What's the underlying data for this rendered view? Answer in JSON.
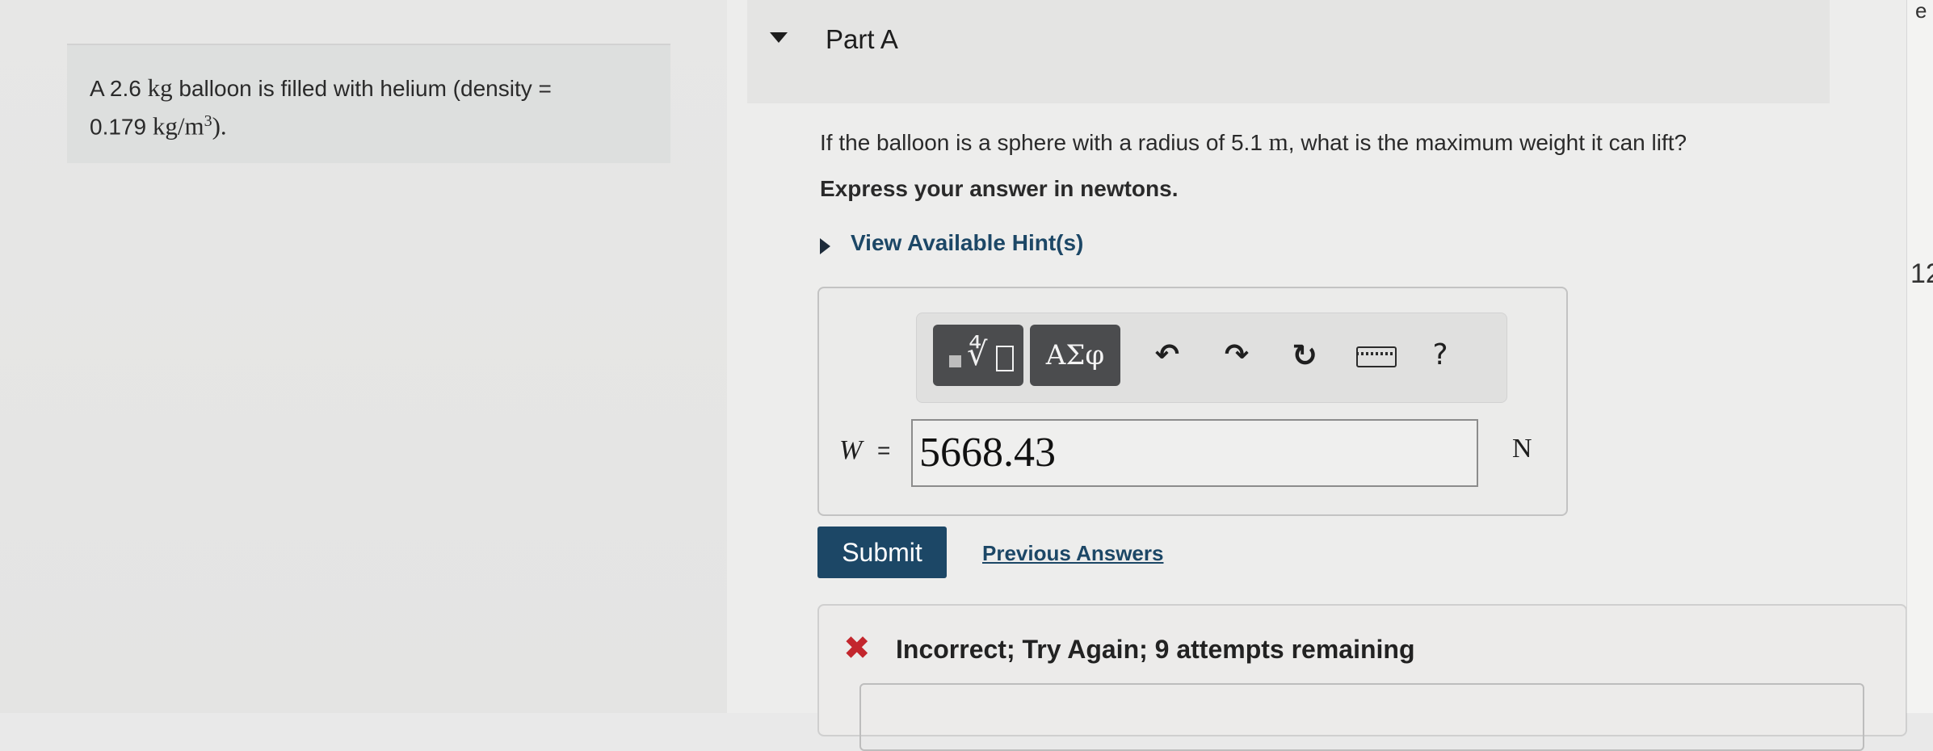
{
  "problem": {
    "prefix": "A 2.6 ",
    "mass_unit": "kg",
    "middle": " balloon is filled with helium (density =",
    "density_value": "0.179 ",
    "density_unit": "kg/m",
    "density_exp": "3",
    "suffix": ")."
  },
  "part": {
    "title": "Part A"
  },
  "question": {
    "prefix": "If the balloon is a sphere with a radius of 5.1 ",
    "radius_unit": "m",
    "suffix": ", what is the maximum weight it can lift?"
  },
  "instruction": "Express your answer in newtons.",
  "hint_label": "View Available Hint(s)",
  "toolbar": {
    "greek_label": "ΑΣφ",
    "undo_glyph": "↶",
    "redo_glyph": "↷",
    "reset_glyph": "↻",
    "help_label": "?"
  },
  "answer": {
    "variable": "W",
    "equals": "=",
    "value": "5668.43",
    "unit": "N"
  },
  "actions": {
    "submit_label": "Submit",
    "previous_answers_label": "Previous Answers"
  },
  "feedback": {
    "icon": "✖",
    "message": "Incorrect; Try Again; 9 attempts remaining"
  },
  "right_edge_fragments": {
    "top": "e",
    "middle": "12"
  },
  "colors": {
    "link_blue": "#1c4766",
    "submit_bg": "#1c4766",
    "error_red": "#c3262d",
    "toolbar_dark": "#4b4c4e"
  }
}
